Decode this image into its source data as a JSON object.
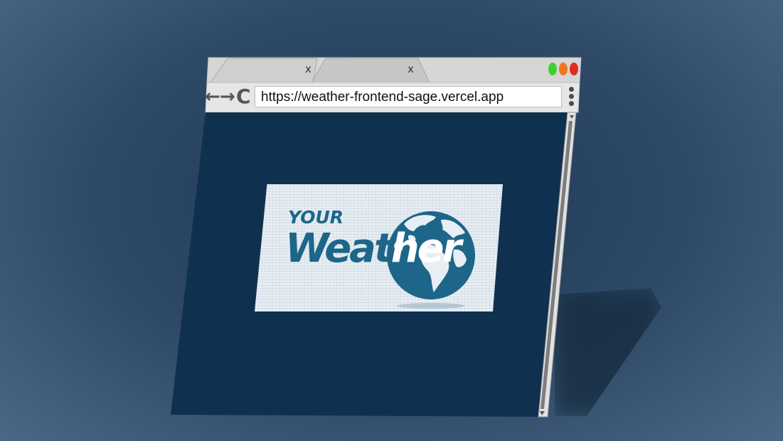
{
  "browser": {
    "tabs": [
      {
        "close_label": "x"
      },
      {
        "close_label": "x"
      }
    ],
    "window_controls": {
      "green": "#3fd12b",
      "orange": "#f0751b",
      "red": "#e22a1f"
    },
    "nav": {
      "back_glyph": "←",
      "forward_glyph": "→",
      "reload_glyph": "C"
    },
    "url": "https://weather-frontend-sage.vercel.app",
    "page_background": "#0f314f"
  },
  "logo": {
    "line1": "YOUR",
    "line2_dark": "Weat",
    "line2_light": "her",
    "brand_color": "#1d6689"
  }
}
